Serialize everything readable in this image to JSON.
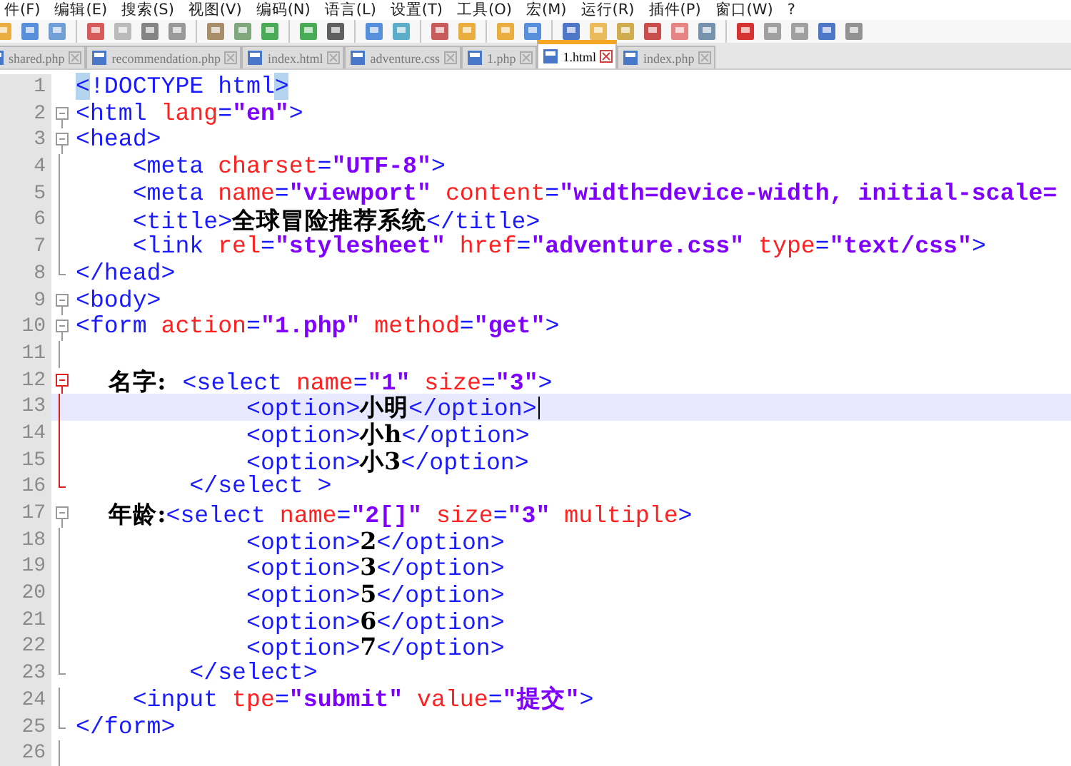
{
  "menu": [
    "件(F)",
    "编辑(E)",
    "搜索(S)",
    "视图(V)",
    "编码(N)",
    "语言(L)",
    "设置(T)",
    "工具(O)",
    "宏(M)",
    "运行(R)",
    "插件(P)",
    "窗口(W)",
    "?"
  ],
  "tabs": [
    {
      "label": "shared.php",
      "selected": false
    },
    {
      "label": "recommendation.php",
      "selected": false
    },
    {
      "label": "index.html",
      "selected": false
    },
    {
      "label": "adventure.css",
      "selected": false
    },
    {
      "label": "1.php",
      "selected": false
    },
    {
      "label": "1.html",
      "selected": true
    },
    {
      "label": "index.php",
      "selected": false
    }
  ],
  "lines": [
    {
      "number": "1",
      "kind": "plain",
      "current": false,
      "caret": false,
      "tokens": [
        {
          "kind": "match",
          "text": "<"
        },
        {
          "kind": "tag",
          "text": "!DOCTYPE html"
        },
        {
          "kind": "match",
          "text": ">"
        }
      ]
    },
    {
      "number": "2",
      "kind": "open",
      "active": false,
      "current": false,
      "caret": false,
      "tokens": [
        {
          "kind": "tag",
          "text": "<html"
        },
        {
          "kind": "attr",
          "text": " lang"
        },
        {
          "kind": "tag",
          "text": "="
        },
        {
          "kind": "value",
          "text": "\"en\""
        },
        {
          "kind": "tag",
          "text": ">"
        }
      ]
    },
    {
      "number": "3",
      "kind": "open",
      "active": false,
      "current": false,
      "caret": false,
      "tokens": [
        {
          "kind": "tag",
          "text": "<head>"
        }
      ]
    },
    {
      "number": "4",
      "kind": "line",
      "active": false,
      "current": false,
      "caret": false,
      "tokens": [
        {
          "kind": "tag",
          "text": "    <meta"
        },
        {
          "kind": "attr",
          "text": " charset"
        },
        {
          "kind": "tag",
          "text": "="
        },
        {
          "kind": "value",
          "text": "\"UTF-8\""
        },
        {
          "kind": "tag",
          "text": ">"
        }
      ]
    },
    {
      "number": "5",
      "kind": "line",
      "active": false,
      "current": false,
      "caret": false,
      "tokens": [
        {
          "kind": "tag",
          "text": "    <meta"
        },
        {
          "kind": "attr",
          "text": " name"
        },
        {
          "kind": "tag",
          "text": "="
        },
        {
          "kind": "value",
          "text": "\"viewport\""
        },
        {
          "kind": "attr",
          "text": " content"
        },
        {
          "kind": "tag",
          "text": "="
        },
        {
          "kind": "value",
          "text": "\"width=device-width, initial-scale="
        }
      ]
    },
    {
      "number": "6",
      "kind": "line",
      "active": false,
      "current": false,
      "caret": false,
      "tokens": [
        {
          "kind": "tag",
          "text": "    <title>"
        },
        {
          "kind": "text",
          "text": "全球冒险推荐系统"
        },
        {
          "kind": "tag",
          "text": "</title>"
        }
      ]
    },
    {
      "number": "7",
      "kind": "line",
      "active": false,
      "current": false,
      "caret": false,
      "tokens": [
        {
          "kind": "tag",
          "text": "    <link"
        },
        {
          "kind": "attr",
          "text": " rel"
        },
        {
          "kind": "tag",
          "text": "="
        },
        {
          "kind": "value",
          "text": "\"stylesheet\""
        },
        {
          "kind": "attr",
          "text": " href"
        },
        {
          "kind": "tag",
          "text": "="
        },
        {
          "kind": "value",
          "text": "\"adventure.css\""
        },
        {
          "kind": "attr",
          "text": " type"
        },
        {
          "kind": "tag",
          "text": "="
        },
        {
          "kind": "value",
          "text": "\"text/css\""
        },
        {
          "kind": "tag",
          "text": ">"
        }
      ]
    },
    {
      "number": "8",
      "kind": "end",
      "active": false,
      "current": false,
      "caret": false,
      "tokens": [
        {
          "kind": "tag",
          "text": "</head>"
        }
      ]
    },
    {
      "number": "9",
      "kind": "open",
      "active": false,
      "current": false,
      "caret": false,
      "tokens": [
        {
          "kind": "tag",
          "text": "<body>"
        }
      ]
    },
    {
      "number": "10",
      "kind": "open",
      "active": false,
      "current": false,
      "caret": false,
      "tokens": [
        {
          "kind": "tag",
          "text": "<form"
        },
        {
          "kind": "attr",
          "text": " action"
        },
        {
          "kind": "tag",
          "text": "="
        },
        {
          "kind": "value",
          "text": "\"1.php\""
        },
        {
          "kind": "attr",
          "text": " method"
        },
        {
          "kind": "tag",
          "text": "="
        },
        {
          "kind": "value",
          "text": "\"get\""
        },
        {
          "kind": "tag",
          "text": ">"
        }
      ]
    },
    {
      "number": "11",
      "kind": "line",
      "active": false,
      "current": false,
      "caret": false
    },
    {
      "number": "12",
      "kind": "open",
      "active": true,
      "current": false,
      "caret": false,
      "tokens": [
        {
          "kind": "text",
          "text": "    名字:  "
        },
        {
          "kind": "tag",
          "text": "<select"
        },
        {
          "kind": "attr",
          "text": " name"
        },
        {
          "kind": "tag",
          "text": "="
        },
        {
          "kind": "value",
          "text": "\"1\""
        },
        {
          "kind": "attr",
          "text": " size"
        },
        {
          "kind": "tag",
          "text": "="
        },
        {
          "kind": "value",
          "text": "\"3\""
        },
        {
          "kind": "tag",
          "text": ">"
        }
      ]
    },
    {
      "number": "13",
      "kind": "line",
      "active": true,
      "current": true,
      "caret": true,
      "tokens": [
        {
          "kind": "tag",
          "text": "            <option>"
        },
        {
          "kind": "text",
          "text": "小明"
        },
        {
          "kind": "tag",
          "text": "</option>"
        }
      ]
    },
    {
      "number": "14",
      "kind": "line",
      "active": true,
      "current": false,
      "caret": false,
      "tokens": [
        {
          "kind": "tag",
          "text": "            <option>"
        },
        {
          "kind": "text",
          "text": "小h"
        },
        {
          "kind": "tag",
          "text": "</option>"
        }
      ]
    },
    {
      "number": "15",
      "kind": "line",
      "active": true,
      "current": false,
      "caret": false,
      "tokens": [
        {
          "kind": "tag",
          "text": "            <option>"
        },
        {
          "kind": "text",
          "text": "小3"
        },
        {
          "kind": "tag",
          "text": "</option>"
        }
      ]
    },
    {
      "number": "16",
      "kind": "end",
      "active": true,
      "current": false,
      "caret": false,
      "tokens": [
        {
          "kind": "tag",
          "text": "        </select >"
        }
      ]
    },
    {
      "number": "17",
      "kind": "open",
      "active": false,
      "current": false,
      "caret": false,
      "tokens": [
        {
          "kind": "text",
          "text": "    年龄:"
        },
        {
          "kind": "tag",
          "text": "<select"
        },
        {
          "kind": "attr",
          "text": " name"
        },
        {
          "kind": "tag",
          "text": "="
        },
        {
          "kind": "value",
          "text": "\"2[]\""
        },
        {
          "kind": "attr",
          "text": " size"
        },
        {
          "kind": "tag",
          "text": "="
        },
        {
          "kind": "value",
          "text": "\"3\""
        },
        {
          "kind": "attr",
          "text": " multiple"
        },
        {
          "kind": "tag",
          "text": ">"
        }
      ]
    },
    {
      "number": "18",
      "kind": "line",
      "active": false,
      "current": false,
      "caret": false,
      "tokens": [
        {
          "kind": "tag",
          "text": "            <option>"
        },
        {
          "kind": "text",
          "text": "2"
        },
        {
          "kind": "tag",
          "text": "</option>"
        }
      ]
    },
    {
      "number": "19",
      "kind": "line",
      "active": false,
      "current": false,
      "caret": false,
      "tokens": [
        {
          "kind": "tag",
          "text": "            <option>"
        },
        {
          "kind": "text",
          "text": "3"
        },
        {
          "kind": "tag",
          "text": "</option>"
        }
      ]
    },
    {
      "number": "20",
      "kind": "line",
      "active": false,
      "current": false,
      "caret": false,
      "tokens": [
        {
          "kind": "tag",
          "text": "            <option>"
        },
        {
          "kind": "text",
          "text": "5"
        },
        {
          "kind": "tag",
          "text": "</option>"
        }
      ]
    },
    {
      "number": "21",
      "kind": "line",
      "active": false,
      "current": false,
      "caret": false,
      "tokens": [
        {
          "kind": "tag",
          "text": "            <option>"
        },
        {
          "kind": "text",
          "text": "6"
        },
        {
          "kind": "tag",
          "text": "</option>"
        }
      ]
    },
    {
      "number": "22",
      "kind": "line",
      "active": false,
      "current": false,
      "caret": false,
      "tokens": [
        {
          "kind": "tag",
          "text": "            <option>"
        },
        {
          "kind": "text",
          "text": "7"
        },
        {
          "kind": "tag",
          "text": "</option>"
        }
      ]
    },
    {
      "number": "23",
      "kind": "end",
      "active": false,
      "current": false,
      "caret": false,
      "tokens": [
        {
          "kind": "tag",
          "text": "        </select>"
        }
      ]
    },
    {
      "number": "24",
      "kind": "line",
      "active": false,
      "current": false,
      "caret": false,
      "tokens": [
        {
          "kind": "tag",
          "text": "    <input"
        },
        {
          "kind": "attr",
          "text": " tpe"
        },
        {
          "kind": "tag",
          "text": "="
        },
        {
          "kind": "value",
          "text": "\"submit\""
        },
        {
          "kind": "attr",
          "text": " value"
        },
        {
          "kind": "tag",
          "text": "="
        },
        {
          "kind": "value",
          "text": "\"提交\""
        },
        {
          "kind": "tag",
          "text": ">"
        }
      ]
    },
    {
      "number": "25",
      "kind": "end",
      "active": false,
      "current": false,
      "caret": false,
      "tokens": [
        {
          "kind": "tag",
          "text": "</form>"
        }
      ]
    },
    {
      "number": "26",
      "kind": "line",
      "active": false,
      "current": false,
      "caret": false
    }
  ]
}
